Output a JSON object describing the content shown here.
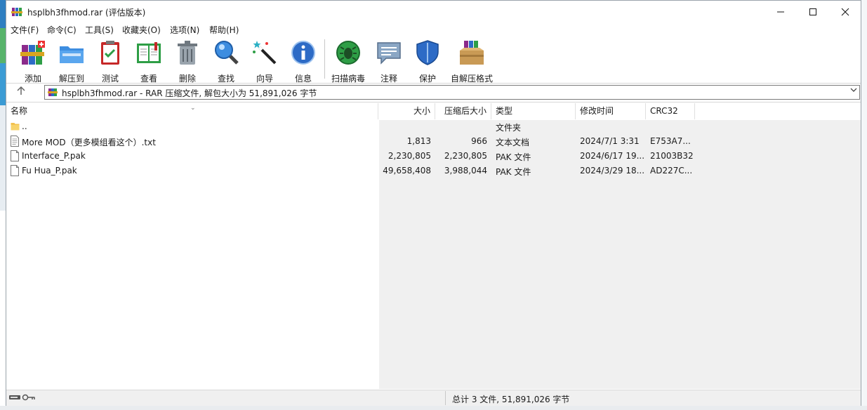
{
  "window": {
    "title": "hsplbh3fhmod.rar (评估版本)"
  },
  "menu": [
    "文件(F)",
    "命令(C)",
    "工具(S)",
    "收藏夹(O)",
    "选项(N)",
    "帮助(H)"
  ],
  "toolbar": [
    {
      "label": "添加",
      "icon": "add-books-icon"
    },
    {
      "label": "解压到",
      "icon": "extract-folder-icon"
    },
    {
      "label": "测试",
      "icon": "test-clipboard-icon"
    },
    {
      "label": "查看",
      "icon": "view-book-icon"
    },
    {
      "label": "删除",
      "icon": "trash-icon"
    },
    {
      "label": "查找",
      "icon": "magnifier-icon"
    },
    {
      "label": "向导",
      "icon": "wizard-wand-icon"
    },
    {
      "label": "信息",
      "icon": "info-icon"
    },
    {
      "label": "扫描病毒",
      "icon": "virus-scan-icon"
    },
    {
      "label": "注释",
      "icon": "comment-icon"
    },
    {
      "label": "保护",
      "icon": "shield-icon"
    },
    {
      "label": "自解压格式",
      "icon": "sfx-box-icon"
    }
  ],
  "address": {
    "text": "hsplbh3fhmod.rar - RAR 压缩文件, 解包大小为 51,891,026 字节"
  },
  "columns": [
    "名称",
    "大小",
    "压缩后大小",
    "类型",
    "修改时间",
    "CRC32"
  ],
  "files": [
    {
      "name": "..",
      "size": "",
      "packed": "",
      "type": "文件夹",
      "modified": "",
      "crc": "",
      "icon": "folder-icon"
    },
    {
      "name": "More MOD（更多模组看这个）.txt",
      "size": "1,813",
      "packed": "966",
      "type": "文本文档",
      "modified": "2024/7/1 3:31",
      "crc": "E753A7...",
      "icon": "text-file-icon"
    },
    {
      "name": "Interface_P.pak",
      "size": "2,230,805",
      "packed": "2,230,805",
      "type": "PAK 文件",
      "modified": "2024/6/17 19...",
      "crc": "21003B32",
      "icon": "file-icon"
    },
    {
      "name": "Fu Hua_P.pak",
      "size": "49,658,408",
      "packed": "3,988,044",
      "type": "PAK 文件",
      "modified": "2024/3/29 18...",
      "crc": "AD227C...",
      "icon": "file-icon"
    }
  ],
  "status": {
    "text": "总计 3 文件, 51,891,026 字节"
  }
}
